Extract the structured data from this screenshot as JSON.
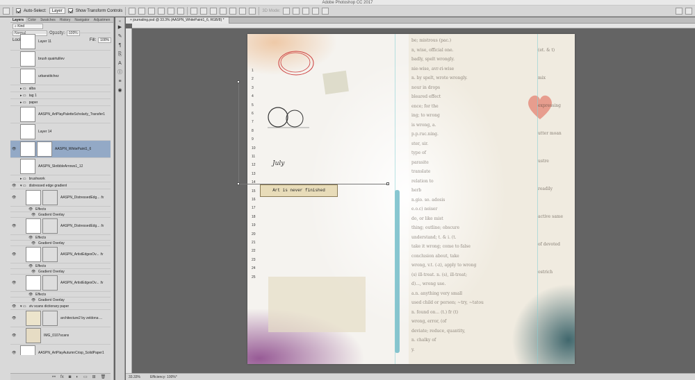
{
  "window": {
    "title": "Adobe Photoshop CC 2017"
  },
  "options_bar": {
    "auto_select_label": "Auto-Select:",
    "auto_select_value": "Layer",
    "show_transform_label": "Show Transform Controls",
    "mode_3d_label": "3D Mode:"
  },
  "layers_panel": {
    "tabs": [
      "Layers",
      "Color",
      "Swatches",
      "History",
      "Navigator",
      "Adjustmen"
    ],
    "filter_kind": "Kind",
    "blend_mode": "Normal",
    "opacity_label": "Opacity:",
    "opacity_value": "100%",
    "lock_label": "Lock:",
    "fill_label": "Fill:",
    "fill_value": "100%",
    "layers": [
      {
        "name": "Layer 11"
      },
      {
        "name": "brush quairtulilev"
      },
      {
        "name": "urbanstitchez"
      },
      {
        "name": "alba"
      },
      {
        "name": "tag 1"
      },
      {
        "name": "paper"
      },
      {
        "name": "AASPN_ArtPlayPaletteScholarly_Transfer1"
      },
      {
        "name": "Layer 14"
      },
      {
        "name": "AASPN_WhitePaint1_6"
      },
      {
        "name": "AASPN_SkribbleArrows1_12"
      },
      {
        "name": "brushwork"
      },
      {
        "name": "distressed edge gradient"
      },
      {
        "name": "AASPN_DistressedEdg...",
        "fx_label": "fx"
      },
      {
        "name": "Effects"
      },
      {
        "name": "Gradient Overlay"
      },
      {
        "name": "AASPN_DistressedEdg...",
        "fx_label": "fx"
      },
      {
        "name": "Effects"
      },
      {
        "name": "Gradient Overlay"
      },
      {
        "name": "AASPN_ArtistEdgesOv...",
        "fx_label": "fx"
      },
      {
        "name": "Effects"
      },
      {
        "name": "Gradient Overlay"
      },
      {
        "name": "AASPN_ArtistEdgesOv...",
        "fx_label": "fx"
      },
      {
        "name": "Effects"
      },
      {
        "name": "Gradient Overlay"
      },
      {
        "name": "viv scans dictionary paper"
      },
      {
        "name": "architecture2 by zeldona ..."
      },
      {
        "name": "IMG_0107scans"
      },
      {
        "name": "AASPN_ArtPlayAutumnCrisp_SolidPaper1"
      }
    ]
  },
  "document": {
    "tab_title": "journaling.psd @ 33.3% (AASPN_WhitePaint1_6, RGB/8) *",
    "zoom": "33.33%",
    "efficiency": "Efficiency: 100%*"
  },
  "canvas_art": {
    "caption": "Art is never finished",
    "handwriting": "July",
    "news_lines": [
      "be; mistrous (pac.)",
      "n, wise, official one.",
      "badly, spelt wrongly.",
      "nie-wise, avr-ri-wise",
      "n. by spelt, wrote wrongly.",
      "nour in drops",
      "bleared effect",
      "ence; for the",
      "ing; to wrong",
      "is wrong, a.",
      "p.p.ruc.ning.",
      "ster, sir.",
      "type of",
      "parasite",
      "translate",
      "relation to",
      "herb",
      "n.gio. so. adosis",
      "e.o.c) neiser",
      "do, or like mist",
      "thing; outline; obscure",
      "understand; t. & i. (t.",
      "take it wrong; come to false",
      "conclusion about, take",
      "wrong, v.t. (-z), apply to wrong",
      "(s) ill-treat. n. (s), ill-treat;",
      "d)..., wrong use.",
      "a.n. anything very small",
      "used child or person; ~try, ~tatou",
      "n. found on... (t.) fr (t)",
      "wrong, error, (of",
      "deviate; reduce, quantity,",
      "n. chalky of",
      "y."
    ],
    "right_column": [
      "(et. & t)",
      "mix",
      "expressing",
      "utter moan",
      "ustre",
      "readily",
      "active same",
      "of devoted",
      "ostrich"
    ],
    "ruler_numbers": [
      "1",
      "2",
      "3",
      "4",
      "5",
      "6",
      "7",
      "8",
      "9",
      "10",
      "11",
      "12",
      "13",
      "14",
      "15",
      "16",
      "17",
      "18",
      "19",
      "20",
      "21",
      "22",
      "23",
      "24",
      "25"
    ]
  }
}
